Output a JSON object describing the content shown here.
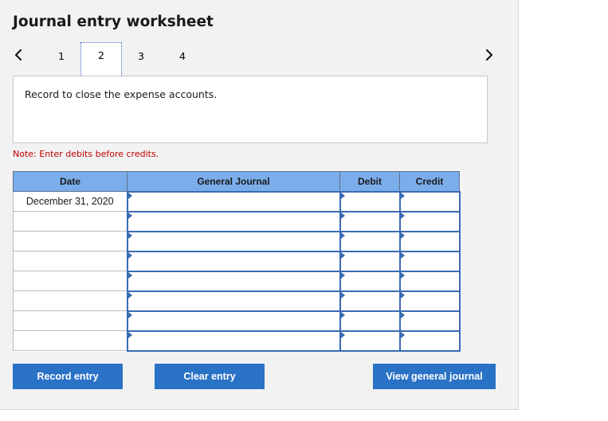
{
  "worksheet": {
    "title": "Journal entry worksheet",
    "steps": [
      "1",
      "2",
      "3",
      "4"
    ],
    "active_step": "2",
    "instruction": "Record to close the expense accounts.",
    "note": "Note: Enter debits before credits."
  },
  "table": {
    "headers": {
      "date": "Date",
      "journal": "General Journal",
      "debit": "Debit",
      "credit": "Credit"
    },
    "rows": [
      {
        "date": "December 31, 2020",
        "journal": "",
        "debit": "",
        "credit": ""
      },
      {
        "date": "",
        "journal": "",
        "debit": "",
        "credit": ""
      },
      {
        "date": "",
        "journal": "",
        "debit": "",
        "credit": ""
      },
      {
        "date": "",
        "journal": "",
        "debit": "",
        "credit": ""
      },
      {
        "date": "",
        "journal": "",
        "debit": "",
        "credit": ""
      },
      {
        "date": "",
        "journal": "",
        "debit": "",
        "credit": ""
      },
      {
        "date": "",
        "journal": "",
        "debit": "",
        "credit": ""
      },
      {
        "date": "",
        "journal": "",
        "debit": "",
        "credit": ""
      }
    ]
  },
  "buttons": {
    "record_entry": "Record entry",
    "clear_entry": "Clear entry",
    "view_general_journal": "View general journal"
  },
  "icons": {
    "prev": "chevron-left-icon",
    "next": "chevron-right-icon",
    "cell_marker": "triangle-right-icon"
  },
  "colors": {
    "header_bg": "#7badea",
    "button_bg": "#2a72c6",
    "note_text": "#c00000",
    "input_border": "#3a6bb3",
    "panel_bg": "#f2f2f2"
  }
}
